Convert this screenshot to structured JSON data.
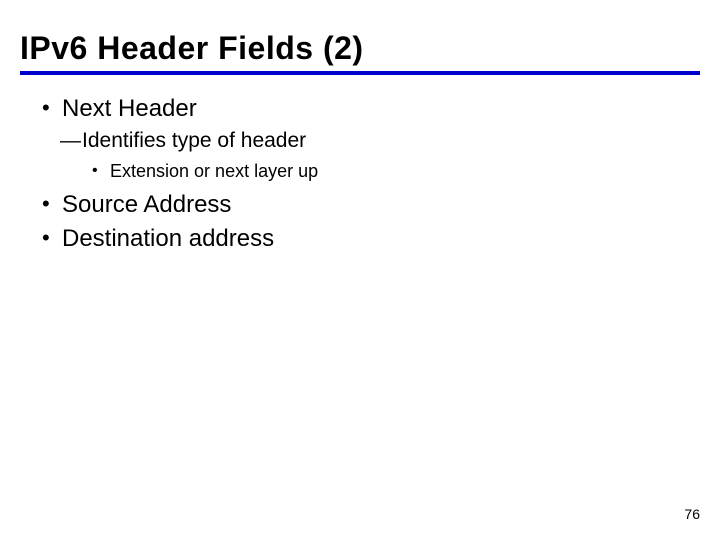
{
  "slide": {
    "title": "IPv6 Header Fields (2)",
    "bullets": {
      "b1": "Next Header",
      "b1_sub1": "Identifies type of header",
      "b1_sub1_sub1": "Extension or next layer up",
      "b2": "Source Address",
      "b3": "Destination address"
    },
    "page_number": "76"
  }
}
